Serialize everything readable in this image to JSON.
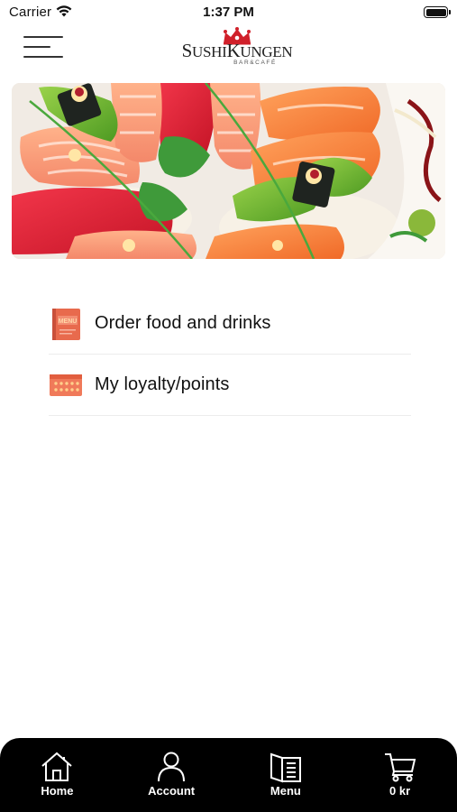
{
  "status_bar": {
    "carrier": "Carrier",
    "time": "1:37 PM"
  },
  "header": {
    "logo": {
      "name_first_letter": "S",
      "name_part1": "USHI",
      "name_second_letter": "K",
      "name_part2": "UNGEN",
      "subtitle": "BAR&CAFÉ",
      "crown_color": "#d0202a"
    }
  },
  "menu": {
    "items": [
      {
        "label": "Order food and drinks",
        "icon": "menu-book-icon"
      },
      {
        "label": "My loyalty/points",
        "icon": "loyalty-card-icon"
      }
    ]
  },
  "tab_bar": {
    "tabs": [
      {
        "label": "Home",
        "icon": "home-icon"
      },
      {
        "label": "Account",
        "icon": "account-icon"
      },
      {
        "label": "Menu",
        "icon": "menu-icon"
      },
      {
        "label": "0 kr",
        "icon": "cart-icon"
      }
    ]
  },
  "colors": {
    "accent": "#f07a5a",
    "tab_bar_bg": "#000000",
    "crown": "#d0202a"
  }
}
